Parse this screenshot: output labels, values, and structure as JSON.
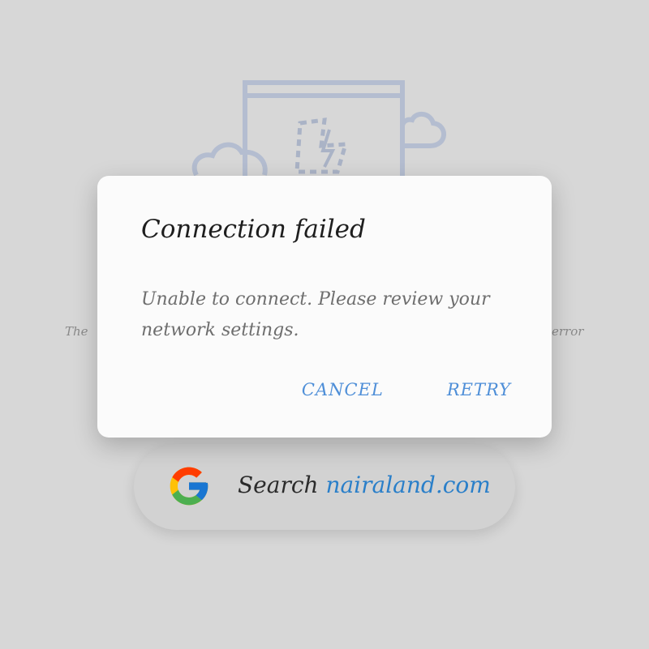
{
  "background": {
    "left_text": "The",
    "right_text": "error"
  },
  "dialog": {
    "title": "Connection failed",
    "message": "Unable to connect. Please review your network settings.",
    "cancel_label": "CANCEL",
    "retry_label": "RETRY"
  },
  "search": {
    "prefix": "Search ",
    "site": "nairaland.com",
    "icon": "google-icon"
  },
  "colors": {
    "accent": "#4f8fd8",
    "link": "#2a7fc9",
    "illustration": "#aeb8cc"
  }
}
